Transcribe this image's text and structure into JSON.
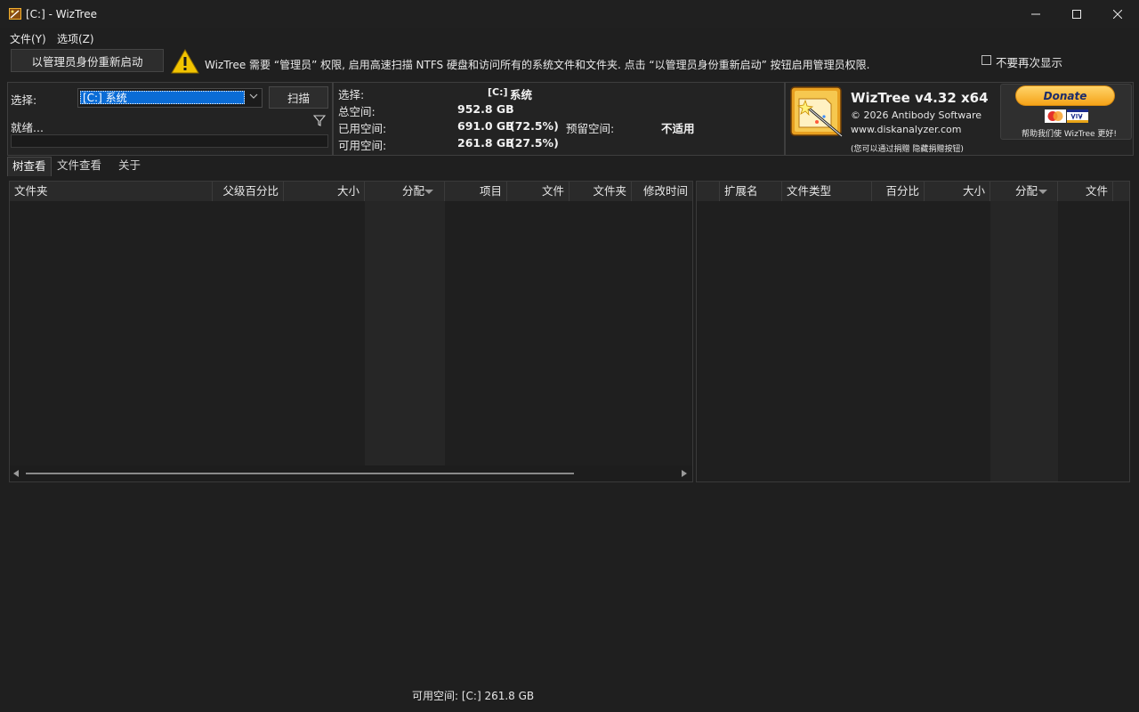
{
  "window": {
    "title": "[C:]  - WizTree",
    "minimize_icon": "minimize-icon",
    "maximize_icon": "maximize-icon",
    "close_icon": "close-icon"
  },
  "menu": {
    "file": "文件(Y)",
    "options": "选项(Z)"
  },
  "admin_bar": {
    "restart_button": "以管理员身份重新启动",
    "message": "WizTree 需要 “管理员” 权限, 启用高速扫描 NTFS 硬盘和访问所有的系统文件和文件夹. 点击 “以管理员身份重新启动” 按钮启用管理员权限.",
    "dont_show_again": "不要再次显示",
    "dont_show_checked": false
  },
  "scan": {
    "select_label": "选择:",
    "drive_value": "[C:] 系统",
    "scan_button": "扫描",
    "status": "就绪...",
    "progress": 0
  },
  "drive_info": {
    "select_label": "选择:",
    "drive": "[C:]",
    "drive_name": "系统",
    "total_label": "总空间:",
    "total_value": "952.8 GB",
    "used_label": "已用空间:",
    "used_value": "691.0 GB",
    "used_pct": "(72.5%)",
    "free_label": "可用空间:",
    "free_value": "261.8 GB",
    "free_pct": "(27.5%)",
    "reserved_label": "预留空间:",
    "reserved_value": "不适用"
  },
  "about": {
    "product": "WizTree v4.32 x64",
    "copyright": "© 2026 Antibody Software",
    "website": "www.diskanalyzer.com",
    "donate_note": "(您可以通过捐赠 隐藏捐赠按钮)",
    "donate_button": "Donate",
    "donate_help": "帮助我们使 WizTree 更好!",
    "cards": [
      "MasterCard",
      "VISA"
    ]
  },
  "tabs": [
    "树查看",
    "文件查看",
    "关于"
  ],
  "tree_table": {
    "columns": [
      "文件夹",
      "父级百分比",
      "大小",
      "分配",
      "项目",
      "文件",
      "文件夹",
      "修改时间"
    ]
  },
  "ext_table": {
    "columns": [
      "扩展名",
      "文件类型",
      "百分比",
      "大小",
      "分配",
      "文件"
    ]
  },
  "statusbar": {
    "text": "可用空间: [C:] 261.8 GB"
  },
  "colors": {
    "background": "#1f1f1f",
    "selection": "#0a6cd6",
    "warning": "#f2c400"
  }
}
